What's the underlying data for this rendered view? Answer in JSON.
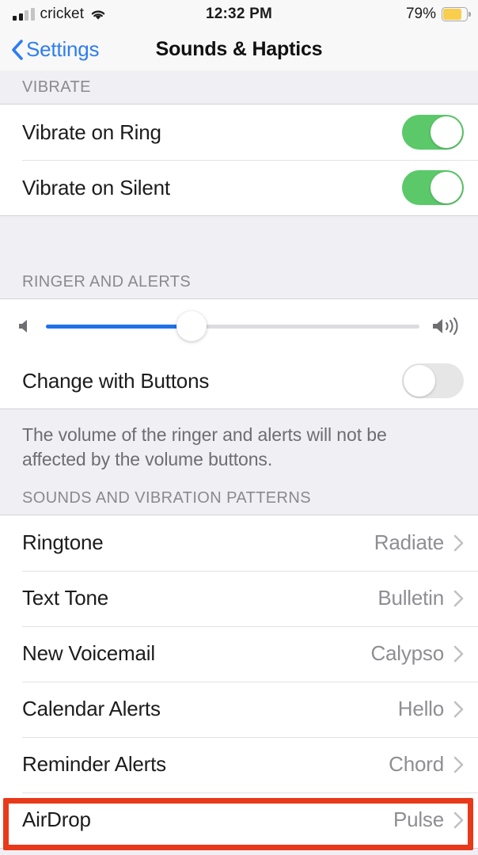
{
  "status_bar": {
    "carrier": "cricket",
    "signal_bars_filled": 2,
    "signal_bars_total": 4,
    "wifi_icon": "wifi-icon",
    "time": "12:32 PM",
    "battery_percent": "79%",
    "battery_level": 79,
    "battery_color": "#F9CE4C"
  },
  "nav": {
    "back_label": "Settings",
    "back_icon": "chevron-left-icon",
    "title": "Sounds & Haptics",
    "tint_color": "#2E7DF2"
  },
  "sections": [
    {
      "header": "VIBRATE",
      "rows": [
        {
          "title": "Vibrate on Ring",
          "control": "switch",
          "value": "on"
        },
        {
          "title": "Vibrate on Silent",
          "control": "switch",
          "value": "on"
        }
      ]
    },
    {
      "header": "RINGER AND ALERTS",
      "slider": {
        "left_icon": "speaker-low-icon",
        "right_icon": "speaker-high-icon",
        "value": 39,
        "min": 0,
        "max": 100,
        "fill_color": "#1E72E8"
      },
      "rows": [
        {
          "title": "Change with Buttons",
          "control": "switch",
          "value": "off"
        }
      ],
      "footer": "The volume of the ringer and alerts will not be affected by the volume buttons."
    },
    {
      "header": "SOUNDS AND VIBRATION PATTERNS",
      "rows": [
        {
          "title": "Ringtone",
          "value": "Radiate",
          "control": "disclosure"
        },
        {
          "title": "Text Tone",
          "value": "Bulletin",
          "control": "disclosure"
        },
        {
          "title": "New Voicemail",
          "value": "Calypso",
          "control": "disclosure"
        },
        {
          "title": "Calendar Alerts",
          "value": "Hello",
          "control": "disclosure"
        },
        {
          "title": "Reminder Alerts",
          "value": "Chord",
          "control": "disclosure"
        },
        {
          "title": "AirDrop",
          "value": "Pulse",
          "control": "disclosure",
          "highlighted": true
        }
      ]
    }
  ],
  "annotation": {
    "highlight_color": "#E8391A",
    "target_row": "AirDrop"
  },
  "colors": {
    "switch_on": "#5BC96A",
    "switch_off": "#E6E6E7",
    "group_background": "#FFFFFF",
    "page_background": "#EFEFF4",
    "value_text": "#8E8E93",
    "header_text": "#8A8A8E"
  }
}
